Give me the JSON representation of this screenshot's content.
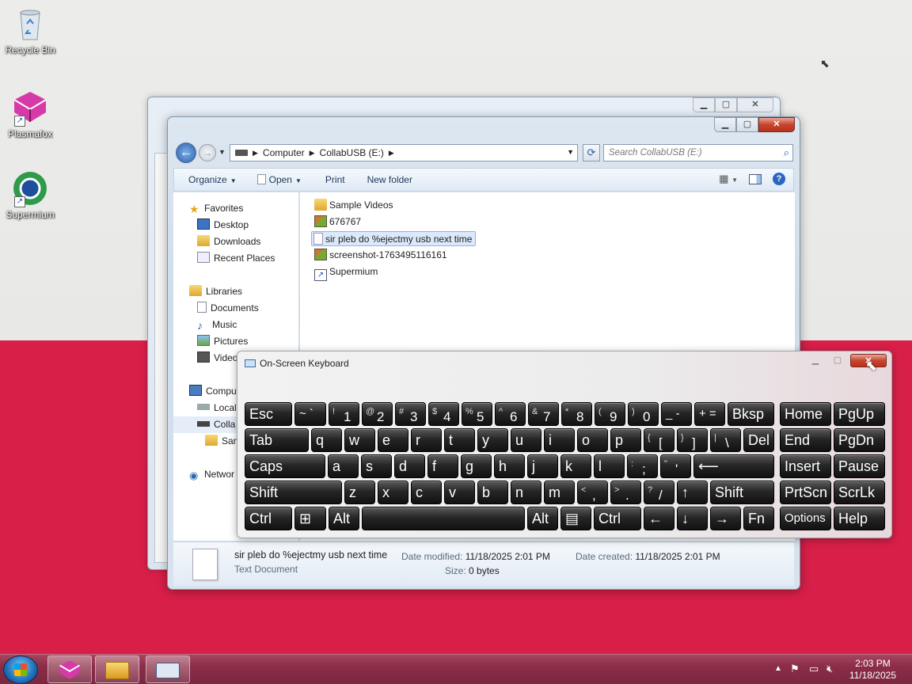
{
  "desktop": {
    "icons": [
      {
        "label": "Recycle Bin"
      },
      {
        "label": "Plasmafox"
      },
      {
        "label": "Supermium"
      }
    ]
  },
  "explorer_front": {
    "address": {
      "segments": [
        "Computer",
        "CollabUSB (E:)"
      ]
    },
    "search_placeholder": "Search CollabUSB (E:)",
    "toolbar": {
      "organize": "Organize",
      "open": "Open",
      "print": "Print",
      "new_folder": "New folder"
    },
    "nav": {
      "favorites": "Favorites",
      "desktop": "Desktop",
      "downloads": "Downloads",
      "recent": "Recent Places",
      "libraries": "Libraries",
      "documents": "Documents",
      "music": "Music",
      "pictures": "Pictures",
      "videos": "Video",
      "computer": "Compu",
      "local": "Local",
      "collab": "Colla",
      "sample": "Sam",
      "network": "Networ"
    },
    "files": [
      {
        "name": "Sample Videos",
        "icon": "folder-icon"
      },
      {
        "name": "676767",
        "icon": "image-icon"
      },
      {
        "name": "sir pleb do %ejectmy usb next time",
        "icon": "text-file-icon"
      },
      {
        "name": "screenshot-1763495116161",
        "icon": "image-icon"
      },
      {
        "name": "Supermium",
        "icon": "shortcut-icon"
      }
    ],
    "details": {
      "name": "sir pleb do %ejectmy usb next time",
      "type": "Text Document",
      "modified_label": "Date modified:",
      "modified": "11/18/2025 2:01 PM",
      "created_label": "Date created:",
      "created": "11/18/2025 2:01 PM",
      "size_label": "Size:",
      "size": "0 bytes"
    }
  },
  "osk": {
    "title": "On-Screen Keyboard",
    "row1": {
      "esc": "Esc",
      "k1": "1",
      "k2": "2",
      "k3": "3",
      "k4": "4",
      "k5": "5",
      "k6": "6",
      "k7": "7",
      "k8": "8",
      "k9": "9",
      "k0": "0",
      "bksp": "Bksp",
      "home": "Home",
      "pgup": "PgUp",
      "s1": "!",
      "s2": "@",
      "s3": "#",
      "s4": "$",
      "s5": "%",
      "s6": "^",
      "s7": "&",
      "s8": "*",
      "s9": "(",
      "s0": ")",
      "tilde": "~ `",
      "minus": "_ -",
      "plus": "+ ="
    },
    "row2": {
      "tab": "Tab",
      "q": "q",
      "w": "w",
      "e": "e",
      "r": "r",
      "t": "t",
      "y": "y",
      "u": "u",
      "i": "i",
      "o": "o",
      "p": "p",
      "lb": "[",
      "rb": "]",
      "bs": "\\",
      "lbs": "{",
      "rbs": "}",
      "bss": "|",
      "del": "Del",
      "end": "End",
      "pgdn": "PgDn"
    },
    "row3": {
      "caps": "Caps",
      "a": "a",
      "s": "s",
      "d": "d",
      "f": "f",
      "g": "g",
      "h": "h",
      "j": "j",
      "k": "k",
      "l": "l",
      "semi": ";",
      "semis": ":",
      "quote": "'",
      "quotes": "\"",
      "enter": "⟵",
      "insert": "Insert",
      "pause": "Pause"
    },
    "row4": {
      "shift": "Shift",
      "z": "z",
      "x": "x",
      "c": "c",
      "v": "v",
      "b": "b",
      "n": "n",
      "m": "m",
      "comma": ",",
      "commas": "<",
      "period": ".",
      "periods": ">",
      "slash": "/",
      "slashs": "?",
      "up": "↑",
      "shift_r": "Shift",
      "prtscn": "PrtScn",
      "scrlk": "ScrLk"
    },
    "row5": {
      "ctrl": "Ctrl",
      "win": "⊞",
      "alt": "Alt",
      "alt_r": "Alt",
      "menu": "▤",
      "ctrl_r": "Ctrl",
      "left": "←",
      "down": "↓",
      "right": "→",
      "fn": "Fn",
      "options": "Options",
      "help": "Help"
    }
  },
  "taskbar": {
    "time": "2:03 PM",
    "date": "11/18/2025"
  }
}
